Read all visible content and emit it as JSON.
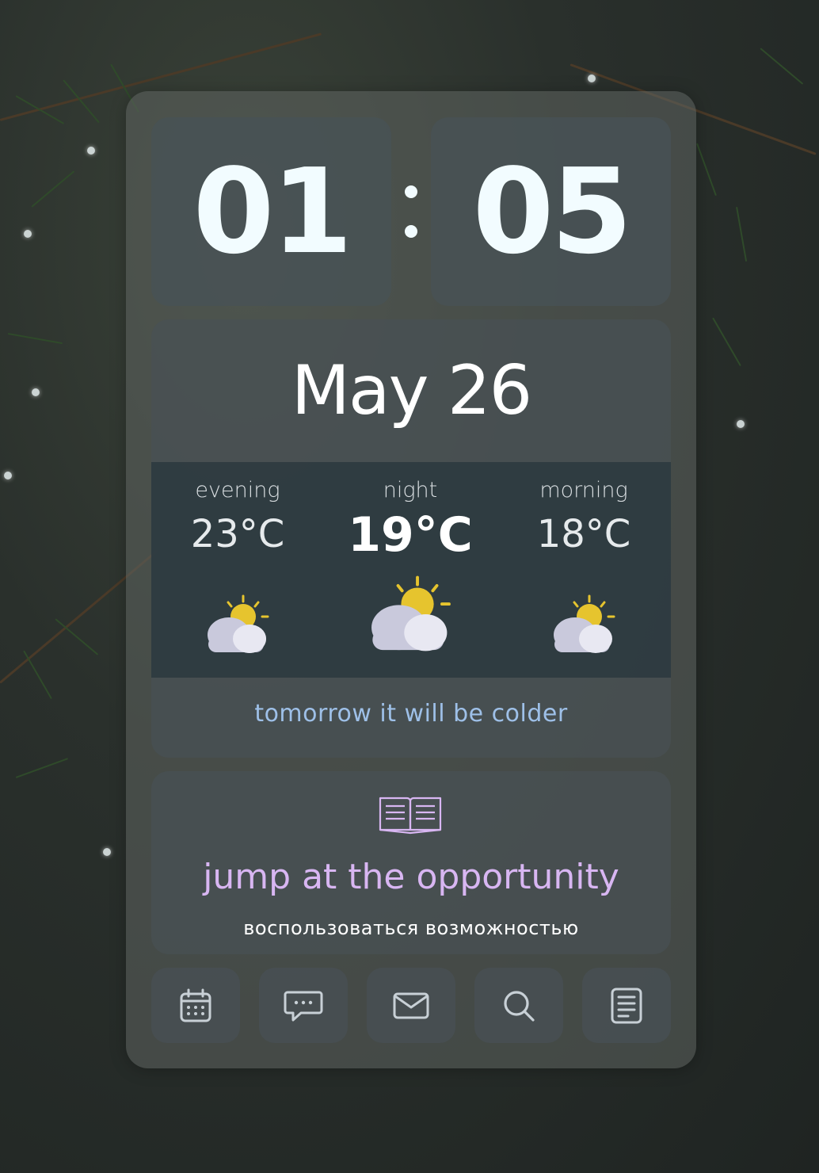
{
  "clock": {
    "hours": "01",
    "minutes": "05"
  },
  "date": "May 26",
  "forecast": [
    {
      "period": "evening",
      "temp": "23°C",
      "icon": "partly-cloudy-icon"
    },
    {
      "period": "night",
      "temp": "19°C",
      "icon": "partly-cloudy-icon"
    },
    {
      "period": "morning",
      "temp": "18°C",
      "icon": "partly-cloudy-icon"
    }
  ],
  "hint": "tomorrow it will be colder",
  "phrase": {
    "icon": "book-icon",
    "text": "jump at the opportunity",
    "translation": "воспользоваться возможностью"
  },
  "dock": [
    {
      "icon": "calendar-icon"
    },
    {
      "icon": "message-icon"
    },
    {
      "icon": "mail-icon"
    },
    {
      "icon": "search-icon"
    },
    {
      "icon": "notes-icon"
    }
  ],
  "colors": {
    "phrase": "#d8b6f2",
    "hint": "#9ec0e8",
    "sun": "#e6c42e",
    "cloud": "#c9c9dc"
  }
}
